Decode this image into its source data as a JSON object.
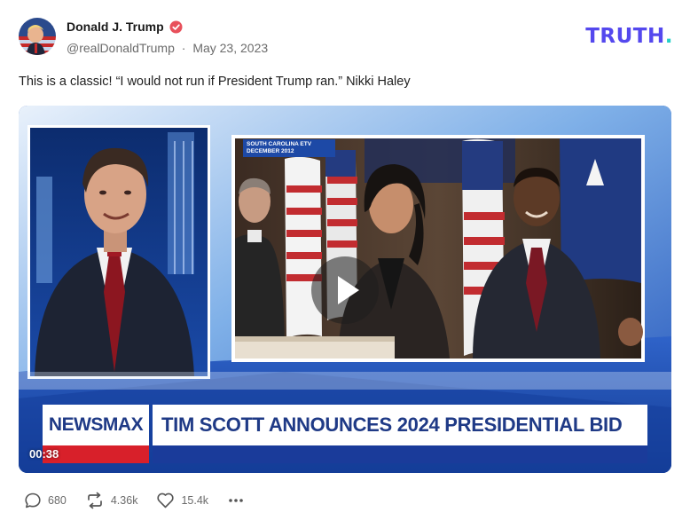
{
  "post": {
    "author_name": "Donald J. Trump",
    "handle": "@realDonaldTrump",
    "separator": "·",
    "date": "May 23, 2023",
    "text": "This is a classic! “I would not run if President Trump ran.” Nikki Haley"
  },
  "brand": {
    "name": "TRUTH",
    "dot": ".",
    "primary_color": "#5448ee",
    "dot_color": "#25d0c8"
  },
  "video": {
    "timestamp": "00:38",
    "network": "NEWSMAX",
    "headline": "TIM SCOTT ANNOUNCES 2024 PRESIDENTIAL BID",
    "inset_label_line1": "SOUTH CAROLINA ETV",
    "inset_label_line2": "DECEMBER 2012",
    "play_icon": "play-icon"
  },
  "actions": {
    "replies": "680",
    "retruths": "4.36k",
    "likes": "15.4k",
    "reply_icon": "reply-icon",
    "retruth_icon": "retruth-icon",
    "like_icon": "heart-icon",
    "more_icon": "more-icon"
  },
  "colors": {
    "verified": "#e8505b",
    "network_blue": "#1f3a86",
    "network_red": "#d8202a"
  }
}
